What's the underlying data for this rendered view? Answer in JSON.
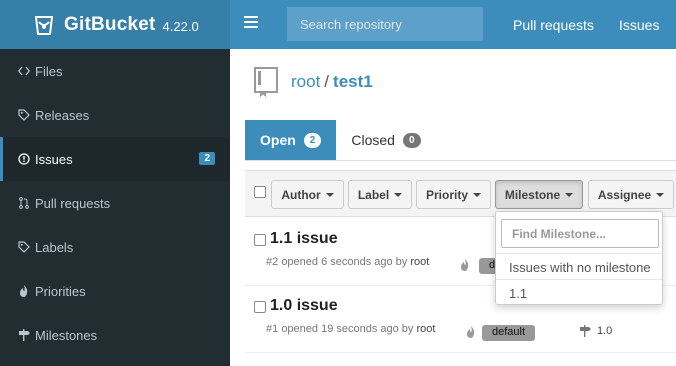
{
  "brand": {
    "name": "GitBucket",
    "version": "4.22.0"
  },
  "header": {
    "search_placeholder": "Search repository",
    "nav": [
      "Pull requests",
      "Issues"
    ]
  },
  "sidebar": {
    "items": [
      {
        "label": "Files",
        "icon": "code-icon"
      },
      {
        "label": "Releases",
        "icon": "tag-icon"
      },
      {
        "label": "Issues",
        "icon": "issue-opened-icon",
        "badge": "2",
        "active": true
      },
      {
        "label": "Pull requests",
        "icon": "git-pull-request-icon"
      },
      {
        "label": "Labels",
        "icon": "tag-icon"
      },
      {
        "label": "Priorities",
        "icon": "flame-icon"
      },
      {
        "label": "Milestones",
        "icon": "milestone-icon"
      }
    ]
  },
  "repo": {
    "owner": "root",
    "separator": "/",
    "name": "test1"
  },
  "tabs": [
    {
      "label": "Open",
      "count": "2",
      "active": true
    },
    {
      "label": "Closed",
      "count": "0",
      "active": false
    }
  ],
  "filters": [
    "Author",
    "Label",
    "Priority",
    "Milestone",
    "Assignee"
  ],
  "milestone_dropdown": {
    "placeholder": "Find Milestone...",
    "options": [
      "Issues with no milestone",
      "1.1"
    ]
  },
  "issues": [
    {
      "title": "1.1 issue",
      "number": "#2",
      "opened": "opened 6 seconds ago by",
      "author": "root",
      "label": "default",
      "milestone": ""
    },
    {
      "title": "1.0 issue",
      "number": "#1",
      "opened": "opened 19 seconds ago by",
      "author": "root",
      "label": "default",
      "milestone": "1.0"
    }
  ],
  "colors": {
    "primary": "#3c8dbc",
    "sidebar": "#222d32",
    "brand_bg": "#367fa9"
  }
}
